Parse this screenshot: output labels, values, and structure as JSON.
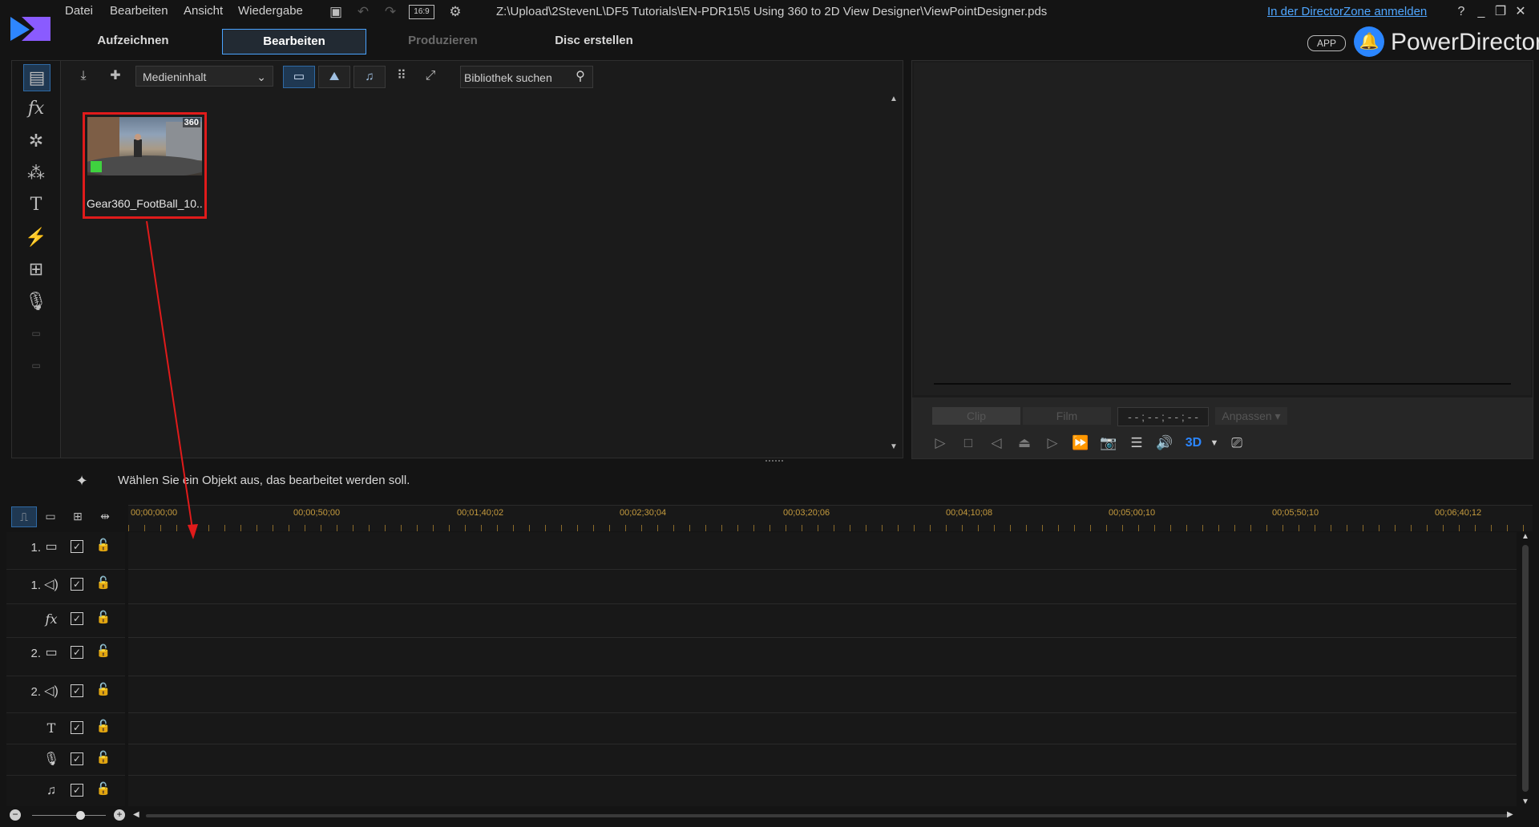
{
  "menu": {
    "items": [
      "Datei",
      "Bearbeiten",
      "Ansicht",
      "Wiedergabe"
    ],
    "aspect_ratio": "16:9"
  },
  "window": {
    "file_path": "Z:\\Upload\\2StevenL\\DF5 Tutorials\\EN-PDR15\\5 Using 360 to 2D View Designer\\ViewPointDesigner.pds",
    "login_link": "In der DirectorZone anmelden",
    "help": "?"
  },
  "mode_tabs": [
    {
      "label": "Aufzeichnen",
      "state": "normal"
    },
    {
      "label": "Bearbeiten",
      "state": "active"
    },
    {
      "label": "Produzieren",
      "state": "disabled"
    },
    {
      "label": "Disc erstellen",
      "state": "normal"
    }
  ],
  "brand": {
    "app_badge": "APP",
    "name": "PowerDirector"
  },
  "rooms": [
    "media-room-icon",
    "fx-icon",
    "particle-icon",
    "pip-icon",
    "title-icon",
    "transition-icon",
    "subtitle-icon",
    "voice-icon",
    "chapter-icon",
    "subtitle-room-icon"
  ],
  "library": {
    "dropdown_value": "Medieninhalt",
    "search_placeholder": "Bibliothek suchen",
    "media": [
      {
        "label": "Gear360_FootBall_10...",
        "badge": "360"
      }
    ]
  },
  "preview": {
    "segments": [
      "Clip",
      "Film"
    ],
    "timecode": "- - ; - - ; - - ; - -",
    "fit": "Anpassen",
    "mode_3d": "3D"
  },
  "status": {
    "text": "Wählen Sie ein Objekt aus, das bearbeitet werden soll."
  },
  "timeline": {
    "ruler": [
      "00;00;00;00",
      "00;00;50;00",
      "00;01;40;02",
      "00;02;30;04",
      "00;03;20;06",
      "00;04;10;08",
      "00;05;00;10",
      "00;05;50;10",
      "00;06;40;12"
    ],
    "tracks": [
      {
        "num": "1.",
        "type": "video-track-icon"
      },
      {
        "num": "1.",
        "type": "audio-track-icon"
      },
      {
        "num": "",
        "type": "fx-track-icon"
      },
      {
        "num": "2.",
        "type": "video-track-icon"
      },
      {
        "num": "2.",
        "type": "audio-track-icon"
      },
      {
        "num": "",
        "type": "title-track-icon"
      },
      {
        "num": "",
        "type": "voice-track-icon"
      },
      {
        "num": "",
        "type": "music-track-icon"
      }
    ]
  },
  "colors": {
    "accent": "#4aa3ff",
    "highlight": "#e01b1b",
    "ruler_text": "#c59b3e"
  }
}
